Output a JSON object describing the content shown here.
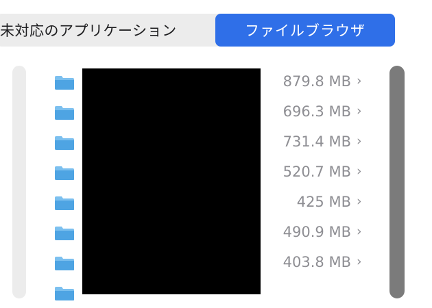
{
  "tabs": {
    "unsupported_apps": "未対応のアプリケーション",
    "file_browser": "ファイルブラウザ"
  },
  "colors": {
    "accent": "#2f6fe8",
    "folder": "#5aaee8",
    "size_text": "#8e8e93"
  },
  "icons": {
    "folder": "folder-icon",
    "chevron": "chevron-right-icon"
  },
  "folders": [
    {
      "size": "879.8 MB",
      "chevron": "›"
    },
    {
      "size": "696.3 MB",
      "chevron": "›"
    },
    {
      "size": "731.4 MB",
      "chevron": "›"
    },
    {
      "size": "520.7 MB",
      "chevron": "›"
    },
    {
      "size": "425 MB",
      "chevron": "›"
    },
    {
      "size": "490.9 MB",
      "chevron": "›"
    },
    {
      "size": "403.8 MB",
      "chevron": "›"
    }
  ]
}
